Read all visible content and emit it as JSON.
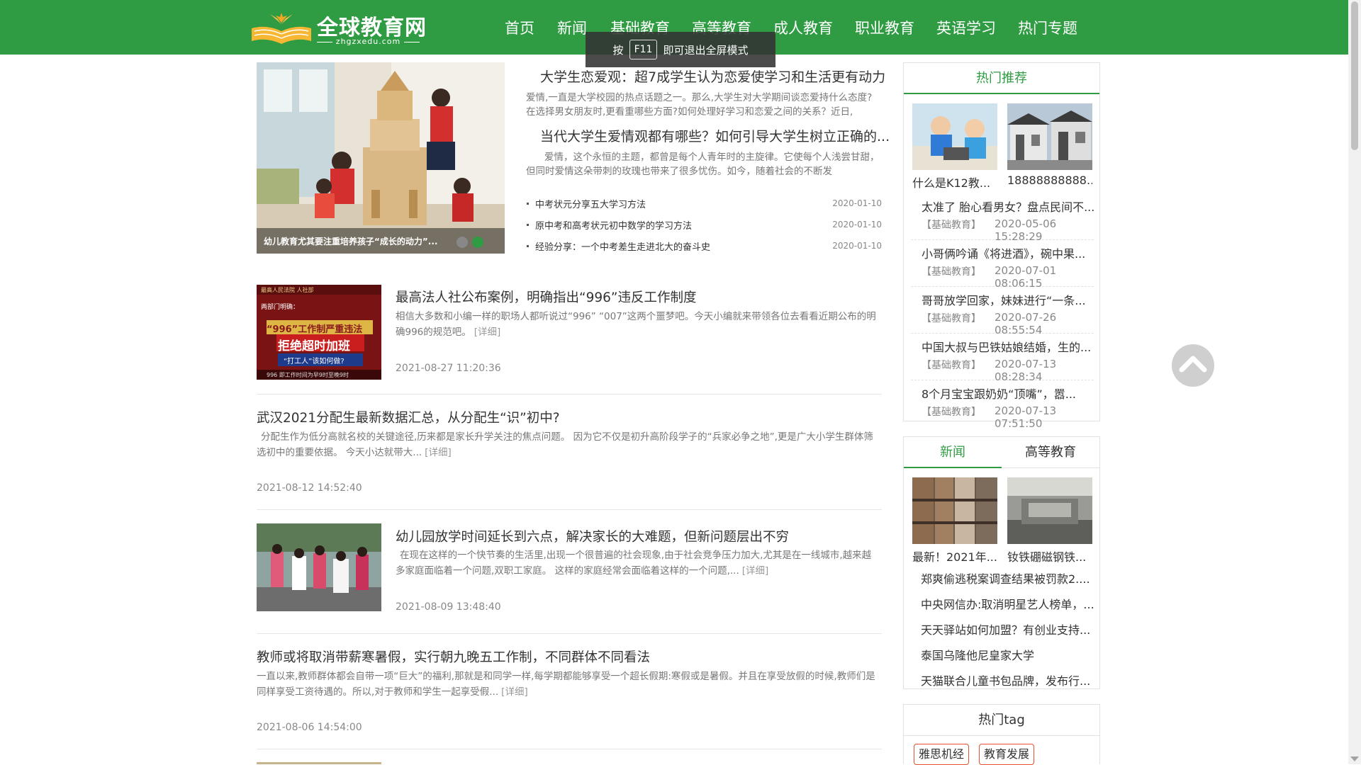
{
  "header": {
    "logo_text": "全球教育网",
    "logo_sub": "zhgzxedu.com",
    "nav": [
      "首页",
      "新闻",
      "基础教育",
      "高等教育",
      "成人教育",
      "职业教育",
      "英语学习",
      "热门专题"
    ]
  },
  "toast": {
    "prefix": "按",
    "key": "F11",
    "suffix": "即可退出全屏模式"
  },
  "featured": {
    "slider_caption": "幼儿教育尤其要注重培养孩子“成长的动力”...",
    "headlines": [
      {
        "title": "大学生恋爱观：超7成学生认为恋爱使学习和生活更有动力",
        "summary": "爱情,一直是大学校园的热点话题之一。那么,大学生对大学期间谈恋爱持什么态度?在选择男女朋友时,更看重哪些方面?如何处理好学习和恋爱之间的关系？近日,"
      },
      {
        "title": "当代大学生爱情观都有哪些？如何引导大学生树立正确的...",
        "summary": "爱情，这个永恒的主题，都曾是每个人青年时的主旋律。它使每个人浅尝甘甜，但同时爱情这朵带刺的玫瑰也带来了很多忧伤。如今，随着社会的不断发"
      }
    ],
    "mini_list": [
      {
        "title": "中考状元分享五大学习方法",
        "date": "2020-01-10"
      },
      {
        "title": "原中考和高考状元初中数学的学习方法",
        "date": "2020-01-10"
      },
      {
        "title": "经验分享：一个中考差生走进北大的奋斗史",
        "date": "2020-01-10"
      }
    ]
  },
  "articles": [
    {
      "title": "最高法人社公布案例，明确指出“996”违反工作制度",
      "summary": "相信大多数和小编一样的职场人都听说过“996” “007”这两个噩梦吧。今天小编就来带领各位去看看近期公布的明确996的规范吧。",
      "more": "[详细]",
      "time": "2021-08-27 11:20:36",
      "has_image": true,
      "image_text": [
        "最高人民法院 人社部",
        "两部门明确：",
        "“996”工作制严重违法",
        "拒绝超时加班",
        "“打工人”该如何做?",
        "996 即工作时间为早9时至晚9时"
      ]
    },
    {
      "title": "武汉2021分配生最新数据汇总，从分配生“识”初中?",
      "summary": "分配生作为低分高就名校的关键途径,历来都是家长升学关注的焦点问题。 因为它不仅是初升高阶段学子的“兵家必争之地”,更是广大小学生群体筛选初中的重要依据。 今天小达就带大...",
      "more": "[详细]",
      "time": "2021-08-12 14:52:40",
      "has_image": false
    },
    {
      "title": "幼儿园放学时间延长到六点，解决家长的大难题，但新问题层出不穷",
      "summary": "在现在这样的一个快节奏的生活里,出现一个很普遍的社会现象,由于社会竞争压力加大,尤其是在一线城市,越来越多家庭面临着一个问题,双职工家庭。 这样的家庭经常会面临着这样的一个问题,...",
      "more": "[详细]",
      "time": "2021-08-09 13:48:40",
      "has_image": true
    },
    {
      "title": "教师或将取消带薪寒暑假，实行朝九晚五工作制，不同群体不同看法",
      "summary": "一直以来,教师群体都会自带一项“巨大”的福利,那就是和同学一样,每学期都能够享受一个超长假期:寒假或是暑假。并且在享受放假的时候,教师们是同样享受工资待遇的。所以,对于教师和学生一起享受假...",
      "more": "[详细]",
      "time": "2021-08-06 14:54:00",
      "has_image": false
    }
  ],
  "sidebar": {
    "hot": {
      "title": "热门推荐",
      "pics": [
        {
          "caption": "什么是K12教..."
        },
        {
          "caption": "18888888888..."
        }
      ],
      "items": [
        {
          "title": "太准了 胎心看男女？盘点民间不...",
          "cat": "【基础教育】",
          "date": "2020-05-06 15:28:29"
        },
        {
          "title": "小哥俩吟诵《将进酒》，碗中果...",
          "cat": "【基础教育】",
          "date": "2020-07-01 08:06:15"
        },
        {
          "title": "哥哥放学回家，妹妹进行“一条...",
          "cat": "【基础教育】",
          "date": "2020-07-26 08:55:54"
        },
        {
          "title": "中国大叔与巴铁姑娘结婚，生的...",
          "cat": "【基础教育】",
          "date": "2020-07-13 08:28:34"
        },
        {
          "title": "8个月宝宝跟奶奶“顶嘴”，嚣...",
          "cat": "【基础教育】",
          "date": "2020-07-13 07:51:50"
        }
      ]
    },
    "news": {
      "tabs": [
        "新闻",
        "高等教育"
      ],
      "pics": [
        {
          "caption": "最新！2021年..."
        },
        {
          "caption": "钕铁硼磁钢铁..."
        }
      ],
      "items": [
        "郑爽偷逃税案调查结果被罚款2....",
        "中央网信办:取消明星艺人榜单，...",
        "天天驿站如何加盟？有创业支持...",
        "泰国乌隆他尼皇家大学",
        "天猫联合儿童书包品牌，发布行..."
      ]
    },
    "tags": {
      "title": "热门tag",
      "items": [
        "雅思机经",
        "教育发展"
      ]
    }
  }
}
